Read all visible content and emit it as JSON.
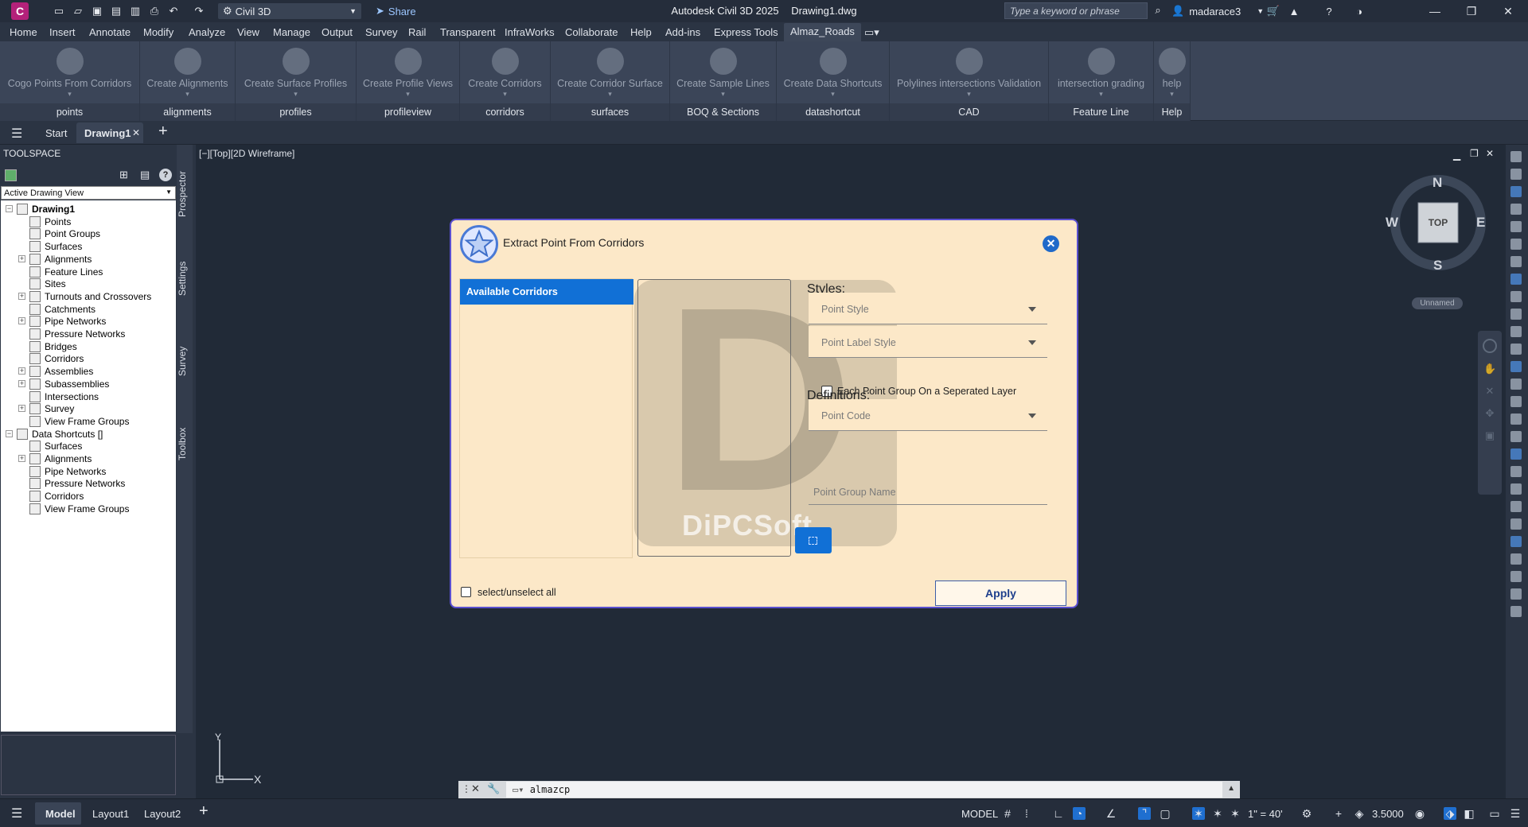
{
  "title_bar": {
    "workspace": "Civil 3D",
    "share": "Share",
    "app_name": "Autodesk Civil 3D 2025",
    "document": "Drawing1.dwg",
    "search_placeholder": "Type a keyword or phrase",
    "user": "madarace3"
  },
  "menu_tabs": [
    "Home",
    "Insert",
    "Annotate",
    "Modify",
    "Analyze",
    "View",
    "Manage",
    "Output",
    "Survey",
    "Rail",
    "Transparent",
    "InfraWorks",
    "Collaborate",
    "Help",
    "Add-ins",
    "Express Tools",
    "Almaz_Roads"
  ],
  "active_menu_tab": "Almaz_Roads",
  "ribbon": {
    "panels": [
      {
        "button": "Cogo Points From Corridors",
        "label": "points",
        "icon": "star-circle-icon"
      },
      {
        "button": "Create Alignments",
        "label": "alignments",
        "icon": "alignment-icon"
      },
      {
        "button": "Create Surface Profiles",
        "label": "profiles",
        "icon": "profile-icon"
      },
      {
        "button": "Create Profile Views",
        "label": "profileview",
        "icon": "profile-view-icon"
      },
      {
        "button": "Create Corridors",
        "label": "corridors",
        "icon": "corridor-icon"
      },
      {
        "button": "Create Corridor Surface",
        "label": "surfaces",
        "icon": "surface-icon"
      },
      {
        "button": "Create Sample Lines",
        "label": "BOQ & Sections",
        "icon": "sample-lines-icon"
      },
      {
        "button": "Create Data Shortcuts",
        "label": "datashortcut",
        "icon": "data-shortcut-icon"
      },
      {
        "button": "Polylines intersections Validation",
        "label": "CAD",
        "icon": "plus-cross-icon"
      },
      {
        "button": "intersection grading",
        "label": "Feature Line",
        "icon": "x-cross-icon"
      },
      {
        "button": "help",
        "label": "Help",
        "icon": "help-icon"
      }
    ]
  },
  "doc_tabs": {
    "start": "Start",
    "active": "Drawing1"
  },
  "toolspace": {
    "title": "TOOLSPACE",
    "view_select": "Active Drawing View",
    "side_tabs": [
      "Prospector",
      "Settings",
      "Survey",
      "Toolbox"
    ],
    "tree": [
      {
        "label": "Drawing1",
        "level": 0,
        "expander": "minus",
        "bold": true
      },
      {
        "label": "Points",
        "level": 1
      },
      {
        "label": "Point Groups",
        "level": 1
      },
      {
        "label": "Surfaces",
        "level": 1
      },
      {
        "label": "Alignments",
        "level": 1,
        "expander": "plus"
      },
      {
        "label": "Feature Lines",
        "level": 1
      },
      {
        "label": "Sites",
        "level": 1
      },
      {
        "label": "Turnouts and Crossovers",
        "level": 1,
        "expander": "plus"
      },
      {
        "label": "Catchments",
        "level": 1
      },
      {
        "label": "Pipe Networks",
        "level": 1,
        "expander": "plus"
      },
      {
        "label": "Pressure Networks",
        "level": 1
      },
      {
        "label": "Bridges",
        "level": 1
      },
      {
        "label": "Corridors",
        "level": 1
      },
      {
        "label": "Assemblies",
        "level": 1,
        "expander": "plus"
      },
      {
        "label": "Subassemblies",
        "level": 1,
        "expander": "plus"
      },
      {
        "label": "Intersections",
        "level": 1
      },
      {
        "label": "Survey",
        "level": 1,
        "expander": "plus"
      },
      {
        "label": "View Frame Groups",
        "level": 1
      },
      {
        "label": "Data Shortcuts []",
        "level": 0,
        "expander": "minus"
      },
      {
        "label": "Surfaces",
        "level": 1
      },
      {
        "label": "Alignments",
        "level": 1,
        "expander": "plus"
      },
      {
        "label": "Pipe Networks",
        "level": 1
      },
      {
        "label": "Pressure Networks",
        "level": 1
      },
      {
        "label": "Corridors",
        "level": 1
      },
      {
        "label": "View Frame Groups",
        "level": 1
      }
    ]
  },
  "viewport": {
    "label": "[−][Top][2D Wireframe]"
  },
  "viewcube": {
    "n": "N",
    "s": "S",
    "e": "E",
    "w": "W",
    "face": "TOP",
    "ucs": "Unnamed"
  },
  "ucs_icon": {
    "x": "X",
    "y": "Y"
  },
  "dialog": {
    "title": "Extract Point From Corridors",
    "list_header": "Available Corridors",
    "styles_heading": "Styles:",
    "point_style": "Point Style",
    "point_label_style": "Point Label Style",
    "separate_layer": "Each Point Group On a Seperated Layer",
    "definitions_heading": "Definitions:",
    "point_code": "Point Code",
    "point_group_name": "Point Group Name",
    "select_all": "select/unselect all",
    "apply": "Apply",
    "watermark": "DiPCSoft",
    "watermark_letter": "D"
  },
  "command_line": {
    "value": "almazcp"
  },
  "status_bar": {
    "layouts": [
      "Model",
      "Layout1",
      "Layout2"
    ],
    "active_layout": "Model",
    "model": "MODEL",
    "scale": "1\" = 40'",
    "annotation_value": "3.5000"
  },
  "colors": {
    "accent": "#1170d6",
    "dialog_bg": "#fce8c8",
    "app_bg": "#2b3443",
    "canvas": "#212a37"
  }
}
